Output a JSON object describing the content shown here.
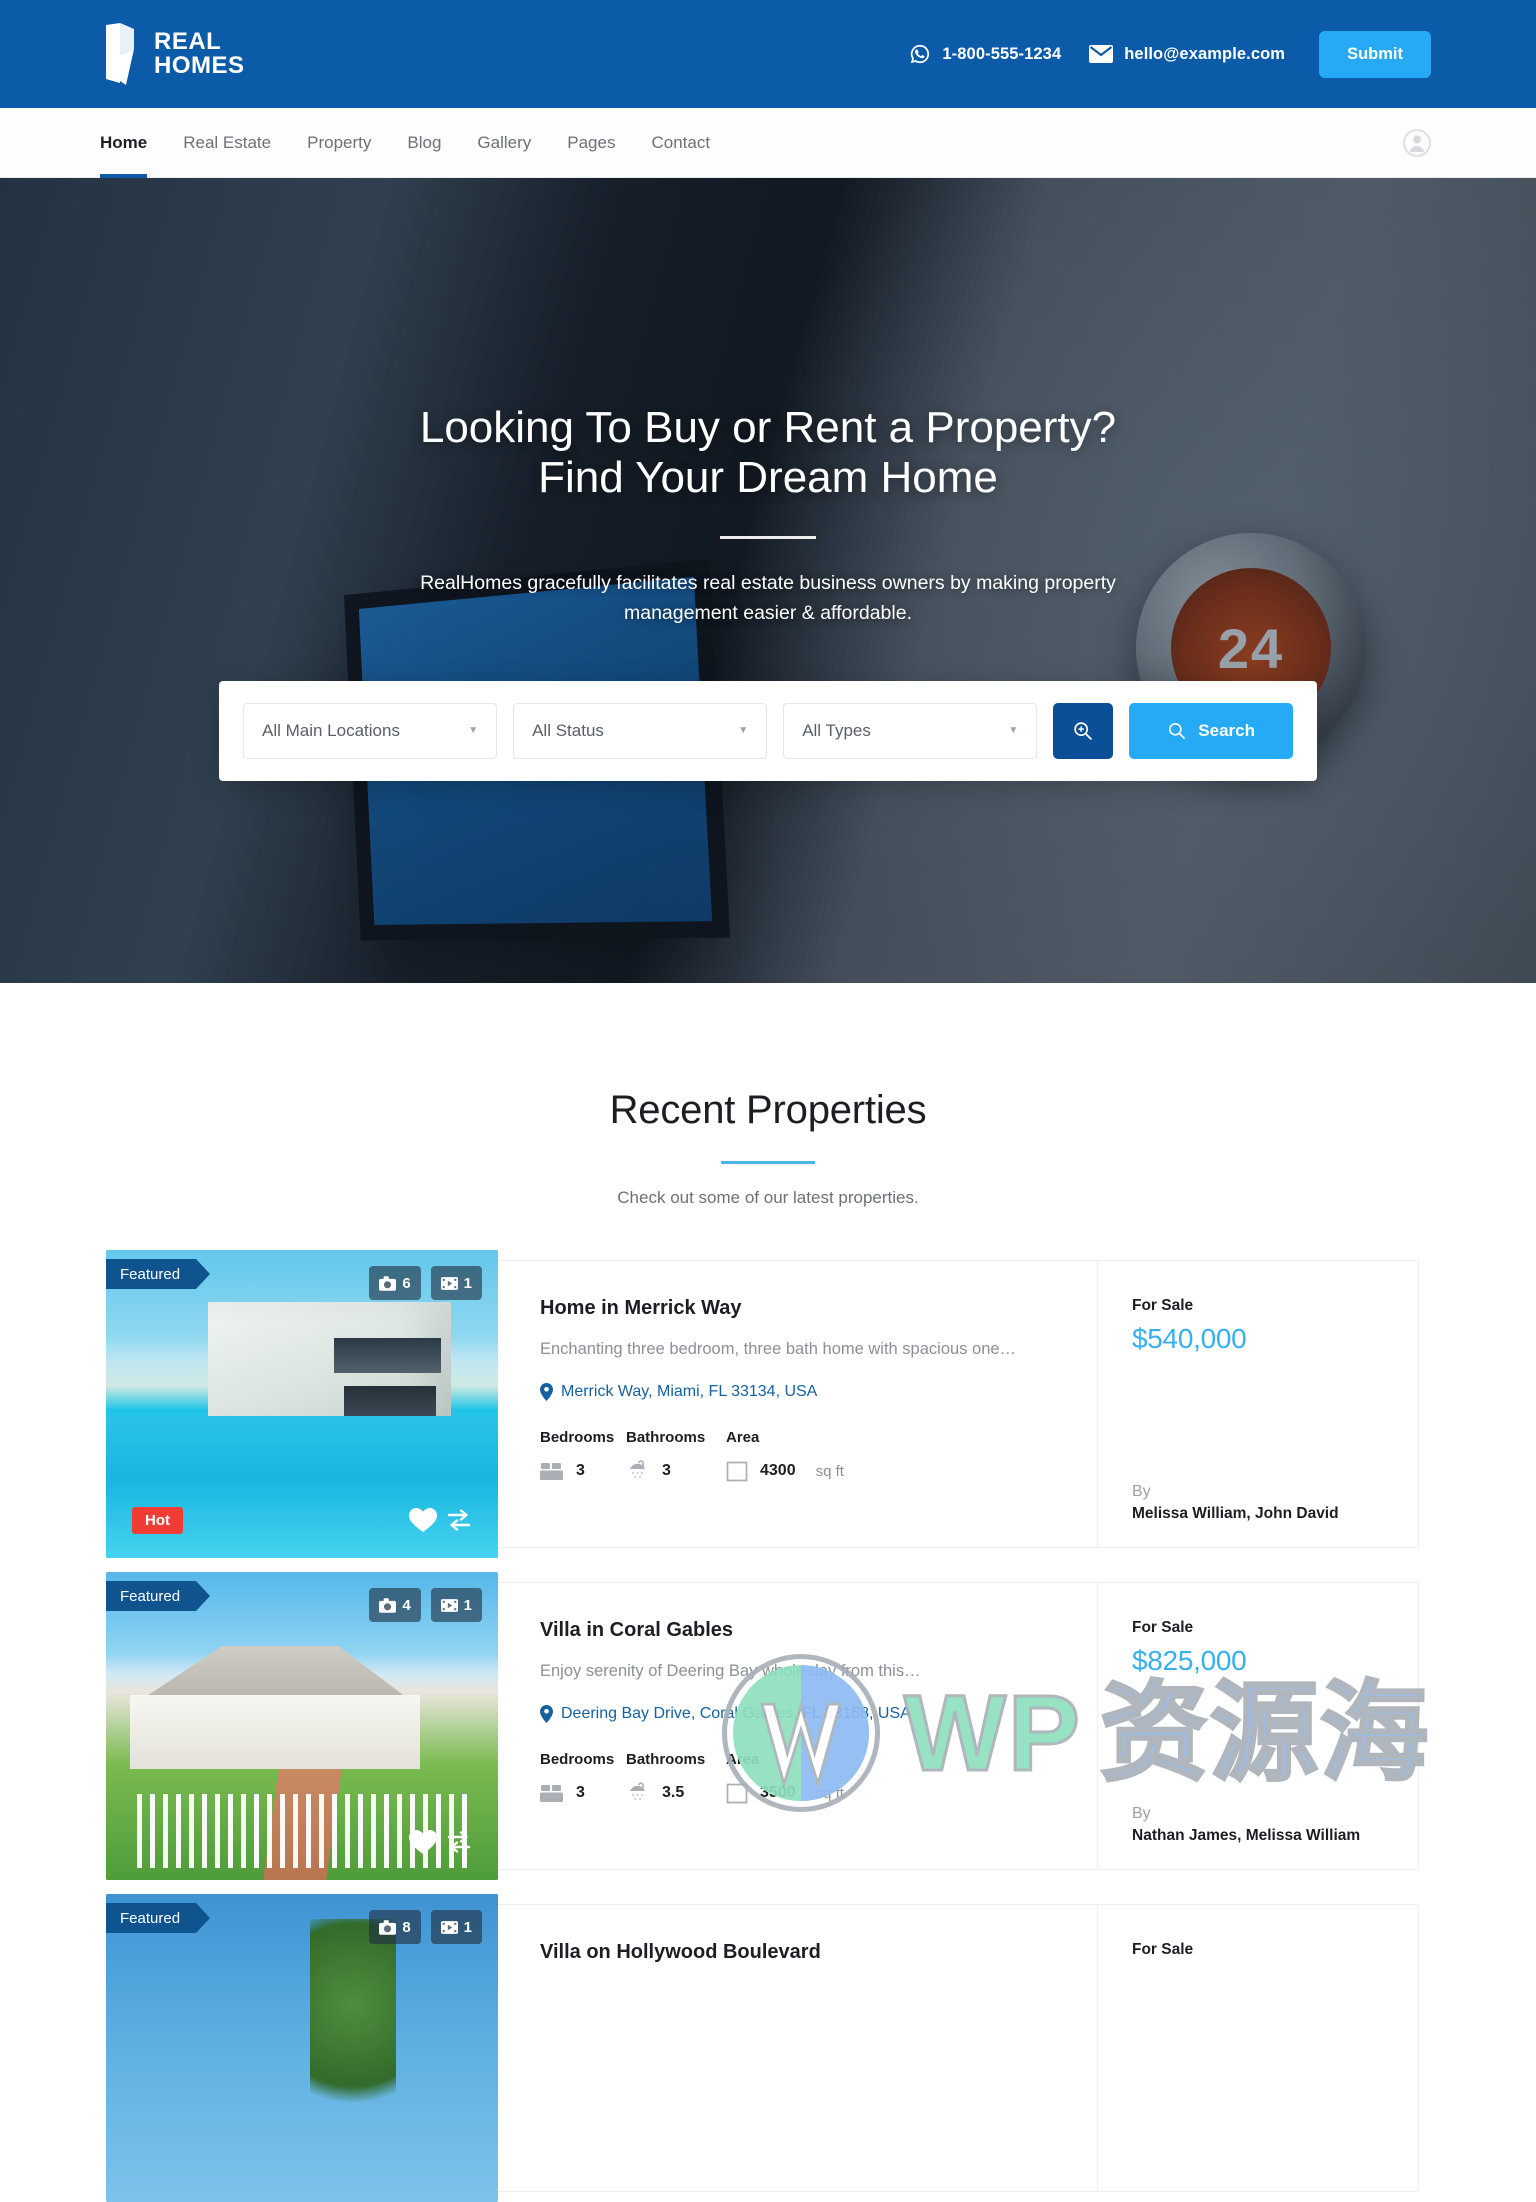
{
  "header": {
    "brand": {
      "line1": "REAL",
      "line2": "HOMES"
    },
    "phone": "1-800-555-1234",
    "email": "hello@example.com",
    "submit_label": "Submit"
  },
  "nav": {
    "items": [
      {
        "label": "Home",
        "active": true
      },
      {
        "label": "Real Estate",
        "active": false
      },
      {
        "label": "Property",
        "active": false
      },
      {
        "label": "Blog",
        "active": false
      },
      {
        "label": "Gallery",
        "active": false
      },
      {
        "label": "Pages",
        "active": false
      },
      {
        "label": "Contact",
        "active": false
      }
    ]
  },
  "hero": {
    "title_line1": "Looking To Buy or Rent a Property?",
    "title_line2": "Find Your Dream Home",
    "subtitle": "RealHomes gracefully facilitates real estate business owners by making property management easier & affordable.",
    "thermostat_value": "24"
  },
  "search": {
    "location_value": "All Main Locations",
    "status_value": "All Status",
    "type_value": "All Types",
    "search_label": "Search",
    "advanced_title": "Advanced Search"
  },
  "section": {
    "title": "Recent Properties",
    "subtitle": "Check out some of our latest properties."
  },
  "labels": {
    "featured": "Featured",
    "hot": "Hot",
    "bedrooms": "Bedrooms",
    "bathrooms": "Bathrooms",
    "area": "Area",
    "area_unit": "sq ft",
    "by": "By"
  },
  "properties": [
    {
      "title": "Home in Merrick Way",
      "description": "Enchanting three bedroom, three bath home with spacious one…",
      "address": "Merrick Way, Miami, FL 33134, USA",
      "bedrooms": "3",
      "bathrooms": "3",
      "area": "4300",
      "status": "For Sale",
      "price": "$540,000",
      "authors": "Melissa William, John David",
      "photo_count": "6",
      "video_count": "1",
      "featured": true,
      "hot": true
    },
    {
      "title": "Villa in Coral Gables",
      "description": "Enjoy serenity of Deering Bay whole day from this…",
      "address": "Deering Bay Drive, Coral Gables, FL 33158, USA",
      "bedrooms": "3",
      "bathrooms": "3.5",
      "area": "3500",
      "status": "For Sale",
      "price": "$825,000",
      "authors": "Nathan James, Melissa William",
      "photo_count": "4",
      "video_count": "1",
      "featured": true,
      "hot": false
    },
    {
      "title": "Villa on Hollywood Boulevard",
      "description": "",
      "address": "",
      "bedrooms": "",
      "bathrooms": "",
      "area": "",
      "status": "For Sale",
      "price": "",
      "authors": "",
      "photo_count": "8",
      "video_count": "1",
      "featured": true,
      "hot": false
    }
  ],
  "watermark": {
    "wp": "WP",
    "cn": "资源海"
  },
  "colors": {
    "brand_blue": "#0b5ba8",
    "accent_cyan": "#27aaf5",
    "price_blue": "#37b0ef",
    "hot_red": "#ef3d35",
    "featured_blue": "#10548f"
  }
}
